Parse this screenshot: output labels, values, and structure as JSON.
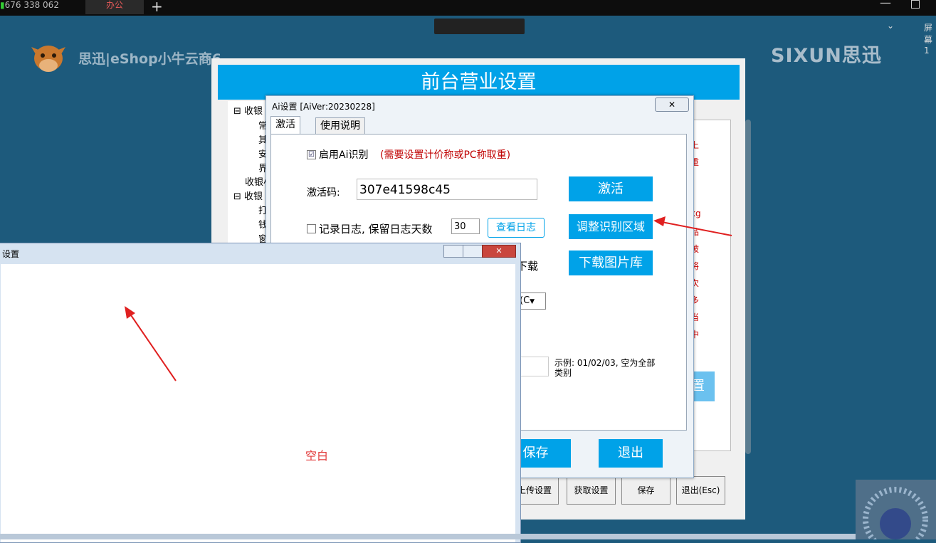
{
  "remote_bar": {
    "tab1_label": "676 338 062",
    "tab2_label": "办公",
    "plus": "+",
    "screen_chevron": "⌄",
    "screen_label": "屏幕1"
  },
  "desktop": {
    "eshop_title": "思迅|eShop小牛云商6",
    "sixun_logo": "SIXUN思迅"
  },
  "main_window": {
    "title": "前台营业设置",
    "tree": [
      "⊟ 收银",
      "常",
      "其",
      "安",
      "界",
      "收银小",
      "⊟ 收银",
      "打",
      "钱",
      "窗"
    ],
    "right_red_lines": [
      "上",
      "重",
      "kg",
      "品",
      "被",
      "将",
      "次",
      "多",
      "当",
      "中"
    ],
    "set_button_partial": "置",
    "bottom_buttons": [
      "上传设置",
      "获取设置",
      "保存",
      "退出(Esc)"
    ]
  },
  "ai_dialog": {
    "title": "Ai设置 [AiVer:20230228]",
    "close": "✕",
    "tabs": [
      "激活",
      "使用说明"
    ],
    "enable_check": "☑",
    "enable_label": "启用Ai识别",
    "enable_note": "(需要设置计价称或PC称取重)",
    "activation_label": "激活码:",
    "activation_code": "307e41598c45",
    "activate_button": "激活",
    "log_label": "记录日志, 保留日志天数",
    "log_days": "30",
    "view_log_button": "查看日志",
    "adjust_button": "调整识别区域",
    "download_partial_label": "下载",
    "download_button": "下载图片库",
    "combo_partial": "(C",
    "example_text": "示例: 01/02/03, 空为全部类别",
    "save_button": "保存",
    "exit_button": "退出"
  },
  "blank_window": {
    "title": "设置",
    "label": "空白"
  },
  "colors": {
    "desktop_bg": "#1d5a7c",
    "accent_blue": "#00a2e8",
    "annotation_red": "#e02020"
  }
}
